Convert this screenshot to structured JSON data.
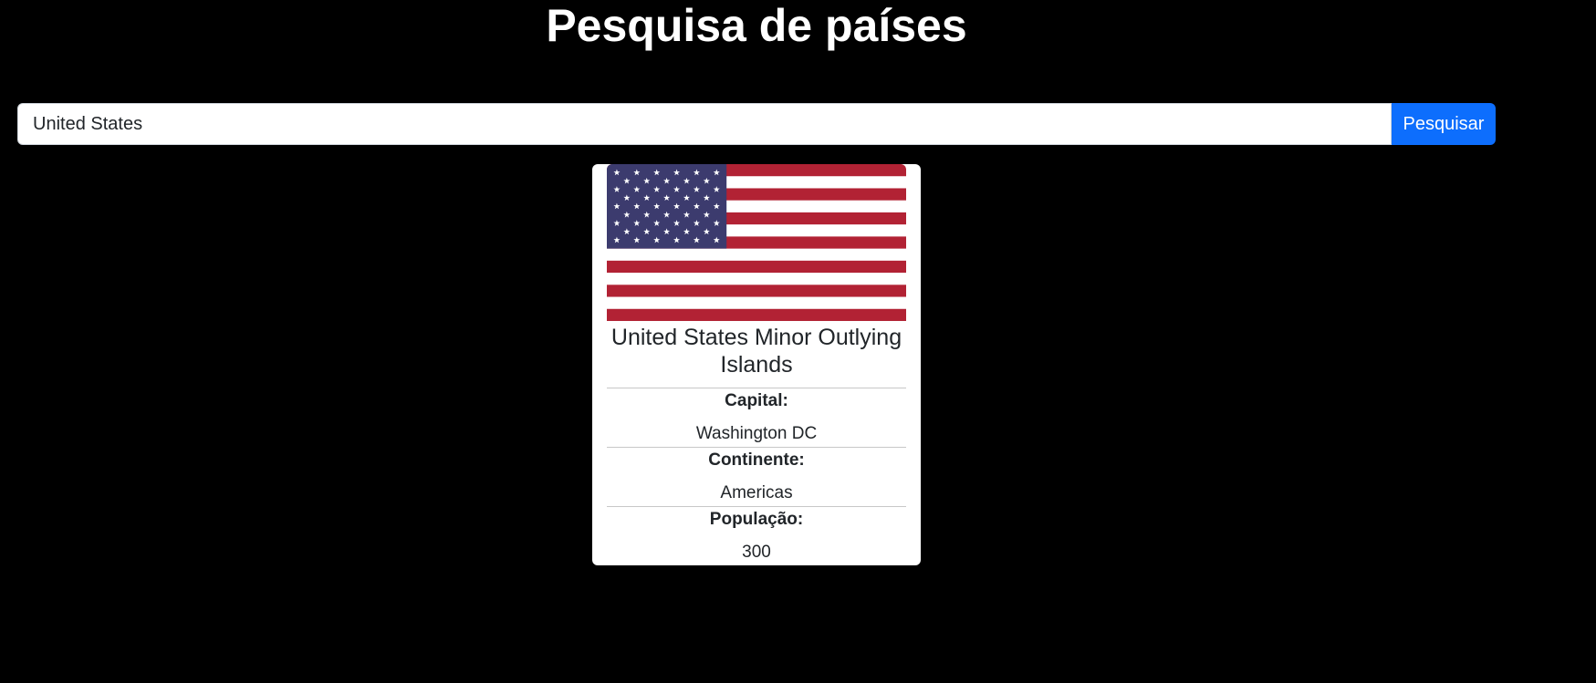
{
  "header": {
    "title": "Pesquisa de países"
  },
  "search": {
    "value": "United States",
    "button_label": "Pesquisar"
  },
  "country": {
    "flag": "us-flag",
    "name": "United States Minor Outlying Islands",
    "capital_label": "Capital:",
    "capital": "Washington DC",
    "continent_label": "Continente:",
    "continent": "Americas",
    "population_label": "População:",
    "population": "300"
  },
  "colors": {
    "background": "#000000",
    "button": "#0d6efd",
    "flag_red": "#b22234",
    "flag_blue": "#3c3b6e"
  }
}
